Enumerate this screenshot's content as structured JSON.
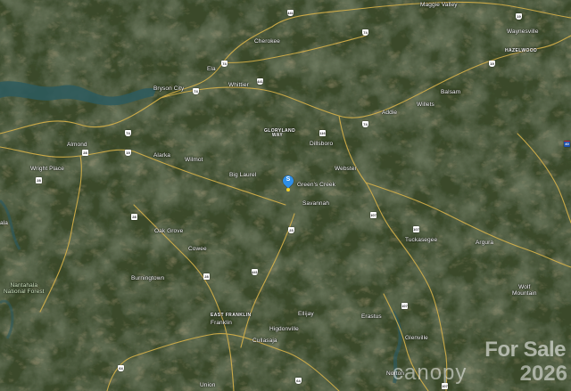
{
  "map": {
    "type": "satellite",
    "colors": {
      "forest_dark": "#23301b",
      "forest_mid": "#3c4b2c",
      "ridge_brown": "#6b5a3a",
      "water": "#2d5a5e",
      "road": "#d8b24a",
      "pin": "#2f8fe8",
      "pin_dot": "#f2d12a"
    },
    "places": [
      {
        "id": "maggie-valley",
        "name": "Maggie Valley"
      },
      {
        "id": "waynesville",
        "name": "Waynesville"
      },
      {
        "id": "hazelwood",
        "name": "HAZELWOOD"
      },
      {
        "id": "cherokee",
        "name": "Cherokee"
      },
      {
        "id": "ela",
        "name": "Ela"
      },
      {
        "id": "bryson-city",
        "name": "Bryson City"
      },
      {
        "id": "whittier",
        "name": "Whittier"
      },
      {
        "id": "balsam",
        "name": "Balsam"
      },
      {
        "id": "addie",
        "name": "Addie"
      },
      {
        "id": "willets",
        "name": "Willets"
      },
      {
        "id": "gloryland-way",
        "name": "GLORYLAND WAY"
      },
      {
        "id": "dillsboro",
        "name": "Dillsboro"
      },
      {
        "id": "almond",
        "name": "Almond"
      },
      {
        "id": "alarka",
        "name": "Alarka"
      },
      {
        "id": "wilmot",
        "name": "Wilmot"
      },
      {
        "id": "wright-place",
        "name": "Wright Place"
      },
      {
        "id": "webster",
        "name": "Webster"
      },
      {
        "id": "big-laurel",
        "name": "Big Laurel"
      },
      {
        "id": "greens-creek",
        "name": "Green's Creek"
      },
      {
        "id": "savannah",
        "name": "Savannah"
      },
      {
        "id": "ala",
        "name": "ala"
      },
      {
        "id": "oak-grove",
        "name": "Oak Grove"
      },
      {
        "id": "cowee",
        "name": "Cowee"
      },
      {
        "id": "tuckasegee",
        "name": "Tuckasegee"
      },
      {
        "id": "argura",
        "name": "Argura"
      },
      {
        "id": "burningtown",
        "name": "Burningtown"
      },
      {
        "id": "wolf-mountain",
        "name": "Wolf\nMountain"
      },
      {
        "id": "nantahala-nf",
        "name": "Nantahala\nNational Forest"
      },
      {
        "id": "east-franklin",
        "name": "EAST FRANKLIN"
      },
      {
        "id": "franklin",
        "name": "Franklin"
      },
      {
        "id": "higdonville",
        "name": "Higdonville"
      },
      {
        "id": "ellijay",
        "name": "Ellijay"
      },
      {
        "id": "erastus",
        "name": "Erastus"
      },
      {
        "id": "cullasaja",
        "name": "Cullasaja"
      },
      {
        "id": "glenville",
        "name": "Glenville"
      },
      {
        "id": "norton",
        "name": "Norton"
      },
      {
        "id": "union",
        "name": "Union"
      }
    ],
    "shields": [
      {
        "id": "s-19-top",
        "label": "19",
        "kind": "us"
      },
      {
        "id": "s-441-top",
        "label": "441",
        "kind": "us"
      },
      {
        "id": "s-74-cherokee",
        "label": "74",
        "kind": "us"
      },
      {
        "id": "s-74-ela",
        "label": "74",
        "kind": "us"
      },
      {
        "id": "s-19-haz",
        "label": "19",
        "kind": "us"
      },
      {
        "id": "s-74-bryson",
        "label": "74",
        "kind": "us"
      },
      {
        "id": "s-441-whittier",
        "label": "441",
        "kind": "us"
      },
      {
        "id": "s-74-addie",
        "label": "74",
        "kind": "us"
      },
      {
        "id": "s-74-almond",
        "label": "74",
        "kind": "us"
      },
      {
        "id": "s-116",
        "label": "116",
        "kind": "state"
      },
      {
        "id": "s-19-alarka",
        "label": "19",
        "kind": "us"
      },
      {
        "id": "s-28-left",
        "label": "28",
        "kind": "state"
      },
      {
        "id": "s-28-wright",
        "label": "28",
        "kind": "state"
      },
      {
        "id": "s-107-webster",
        "label": "107",
        "kind": "state"
      },
      {
        "id": "s-28-oak",
        "label": "28",
        "kind": "state"
      },
      {
        "id": "s-23",
        "label": "23",
        "kind": "us"
      },
      {
        "id": "s-107-tuck",
        "label": "107",
        "kind": "state"
      },
      {
        "id": "s-28-cowee",
        "label": "28",
        "kind": "state"
      },
      {
        "id": "s-441-mid",
        "label": "441",
        "kind": "us"
      },
      {
        "id": "s-107-glen",
        "label": "107",
        "kind": "state"
      },
      {
        "id": "s-64",
        "label": "64",
        "kind": "us"
      },
      {
        "id": "s-40-right",
        "label": "40",
        "kind": "i"
      },
      {
        "id": "s-64-bottom",
        "label": "64",
        "kind": "us"
      },
      {
        "id": "s-107-bottom",
        "label": "107",
        "kind": "state"
      }
    ],
    "marker": {
      "letter": "S"
    },
    "watermark": {
      "line1": "For Sale",
      "brand": "canopy",
      "year": "2026"
    }
  }
}
